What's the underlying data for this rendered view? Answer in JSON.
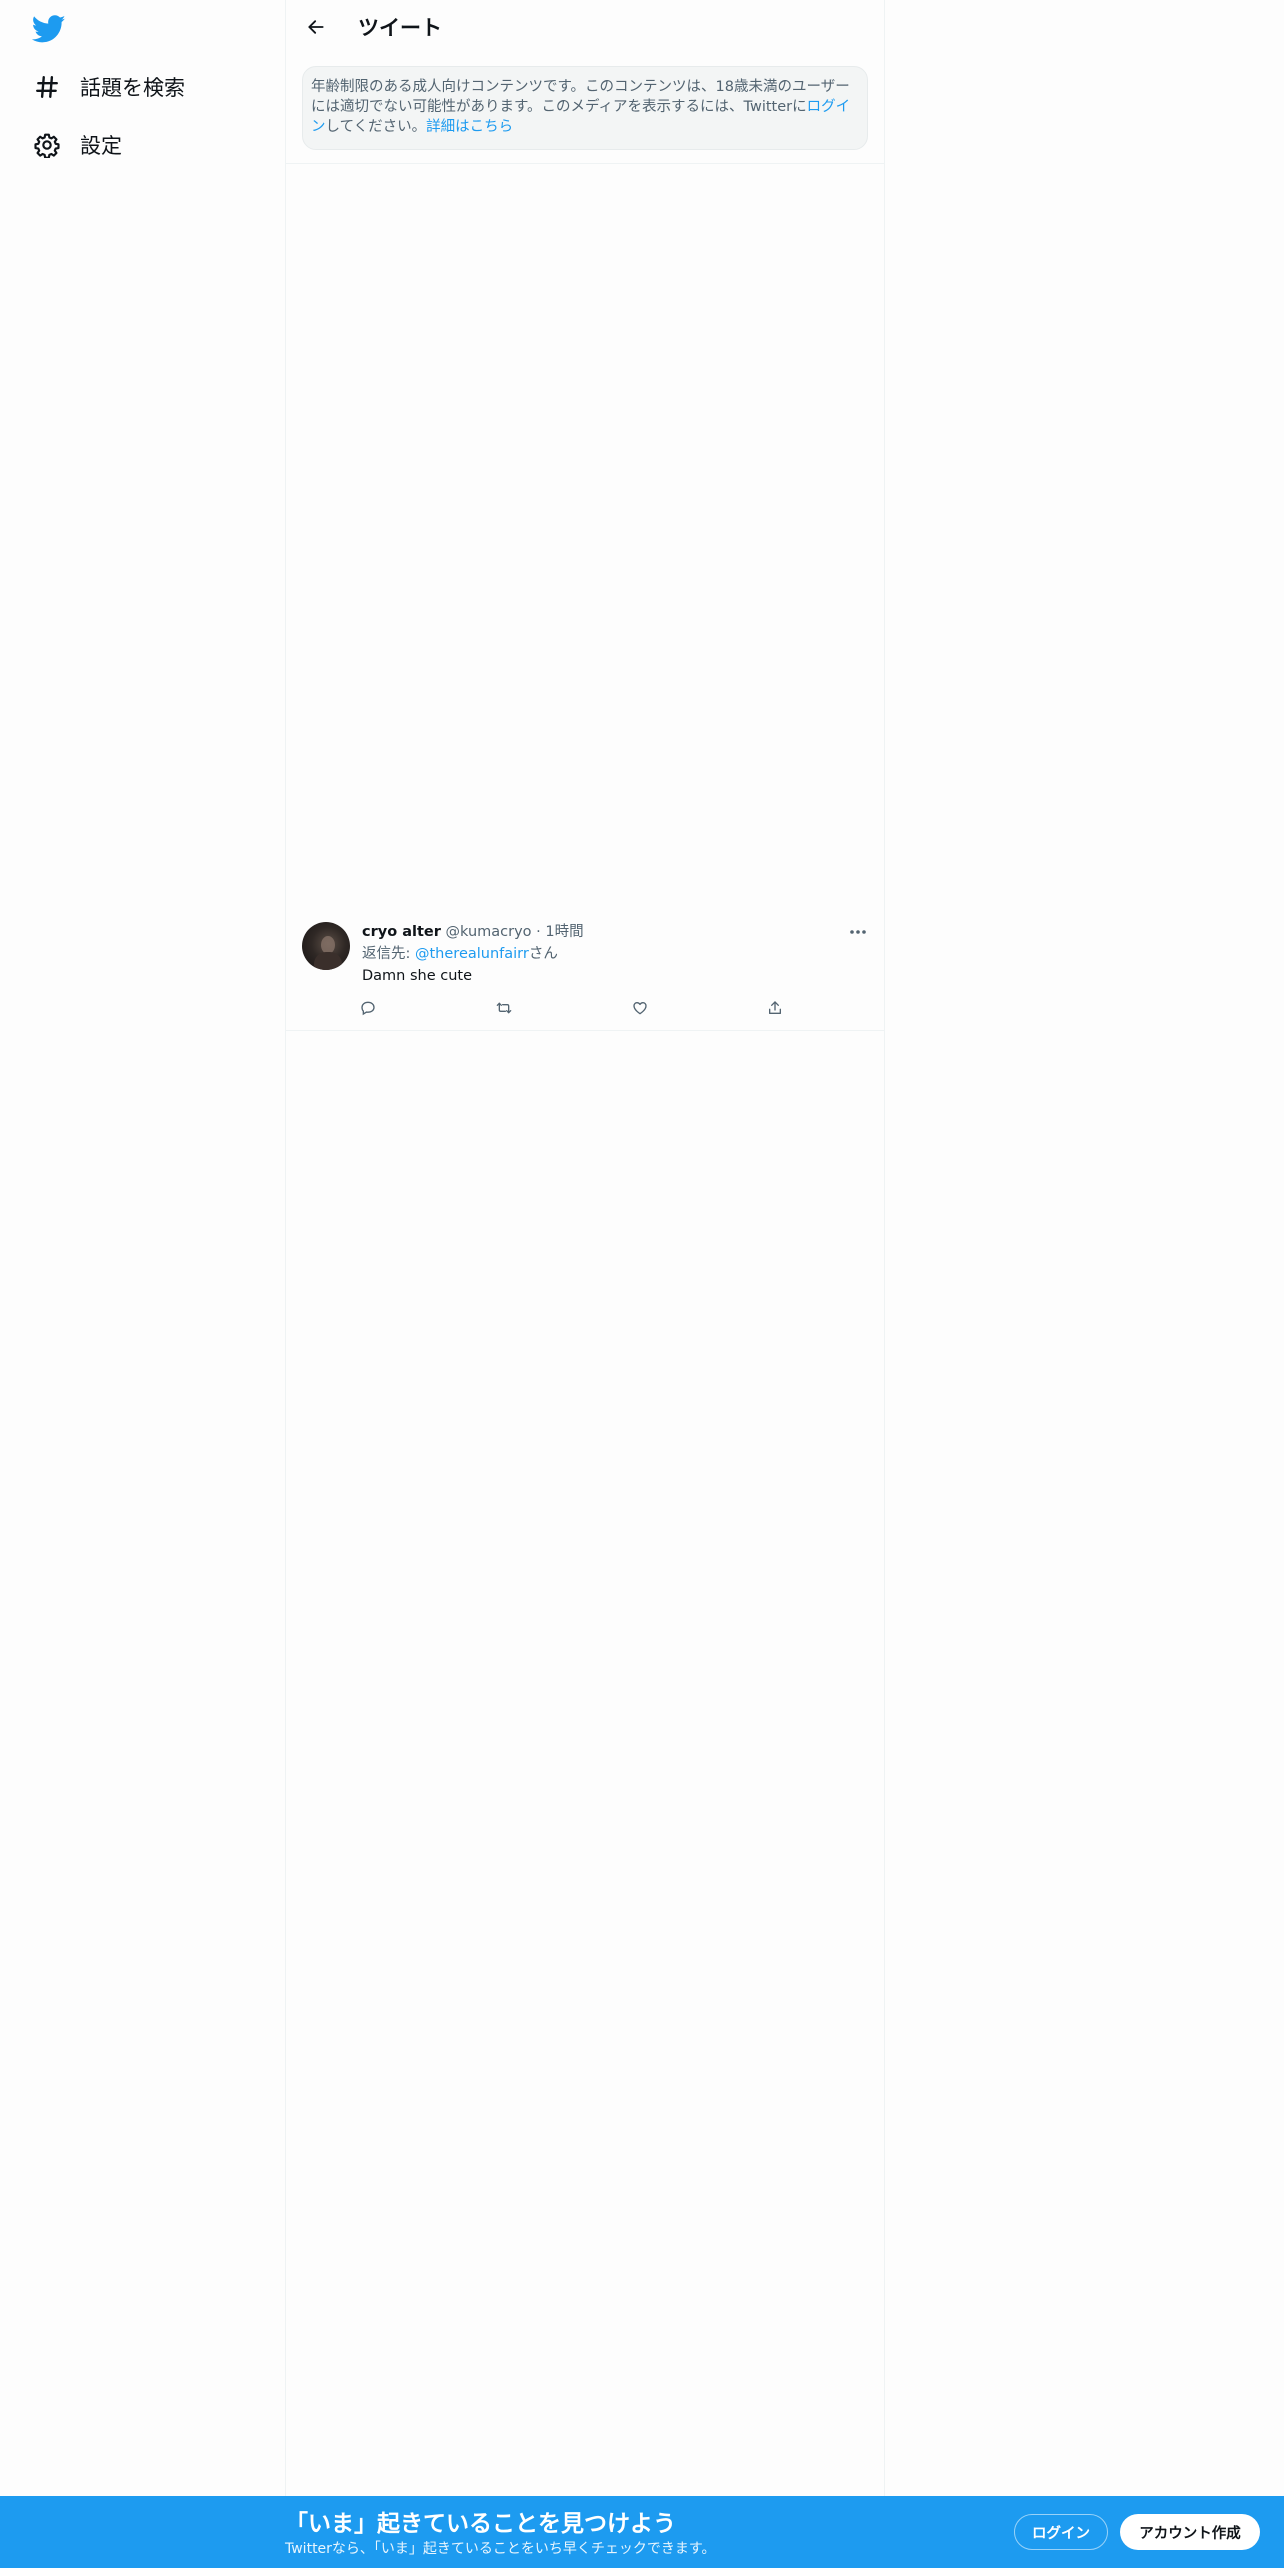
{
  "sidebar": {
    "logo_icon": "twitter-bird-icon",
    "items": [
      {
        "label": "話題を検索",
        "icon": "hashtag-icon"
      },
      {
        "label": "設定",
        "icon": "gear-icon"
      }
    ]
  },
  "header": {
    "back_icon": "arrow-left-icon",
    "title": "ツイート"
  },
  "notice": {
    "text_before_login": "年齢制限のある成人向けコンテンツです。このコンテンツは、18歳未満のユーザーには適切でない可能性があります。このメディアを表示するには、Twitterに",
    "login_link": "ログイン",
    "text_after_login": "してください。",
    "learn_more_link": "詳細はこちら"
  },
  "tweet": {
    "display_name": "cryo alter",
    "handle": "@kumacryo",
    "separator": "·",
    "time": "1時間",
    "reply_prefix": "返信先: ",
    "reply_to": "@therealunfairr",
    "reply_suffix": "さん",
    "text": "Damn she cute",
    "actions": [
      "reply-icon",
      "retweet-icon",
      "like-icon",
      "share-icon"
    ]
  },
  "bottom_bar": {
    "title": "「いま」起きていることを見つけよう",
    "subtitle": "Twitterなら、「いま」起きていることをいち早くチェックできます。",
    "login_label": "ログイン",
    "signup_label": "アカウント作成"
  },
  "colors": {
    "accent": "#1d9bf0",
    "text": "#0f1419",
    "muted": "#536471"
  }
}
